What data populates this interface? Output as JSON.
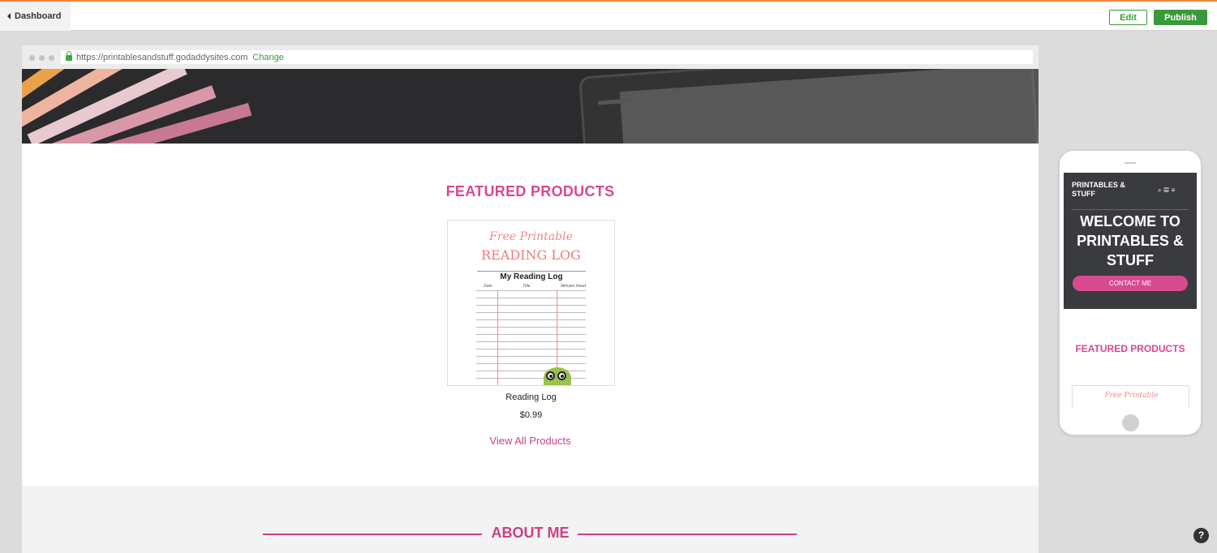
{
  "toolbar": {
    "back_label": "Dashboard",
    "edit_label": "Edit",
    "publish_label": "Publish",
    "accent_color": "#3a9a3a"
  },
  "browser": {
    "url": "https://printablesandstuff.godaddysites.com",
    "change_label": "Change"
  },
  "site": {
    "featured_title": "FEATURED PRODUCTS",
    "product": {
      "image_script": "Free Printable",
      "image_heading": "READING LOG",
      "image_subheading": "My Reading Log",
      "image_columns": [
        "Date",
        "Title",
        "Minutes Read"
      ],
      "name": "Reading Log",
      "price": "$0.99"
    },
    "view_all_label": "View All Products",
    "about_title": "ABOUT ME",
    "brand_color": "#d8488f"
  },
  "mobile": {
    "site_title": "PRINTABLES & STUFF",
    "welcome": "WELCOME TO PRINTABLES & STUFF",
    "contact_label": "CONTACT ME",
    "featured_title": "FEATURED PRODUCTS",
    "product_script": "Free Printable"
  },
  "help_label": "?"
}
